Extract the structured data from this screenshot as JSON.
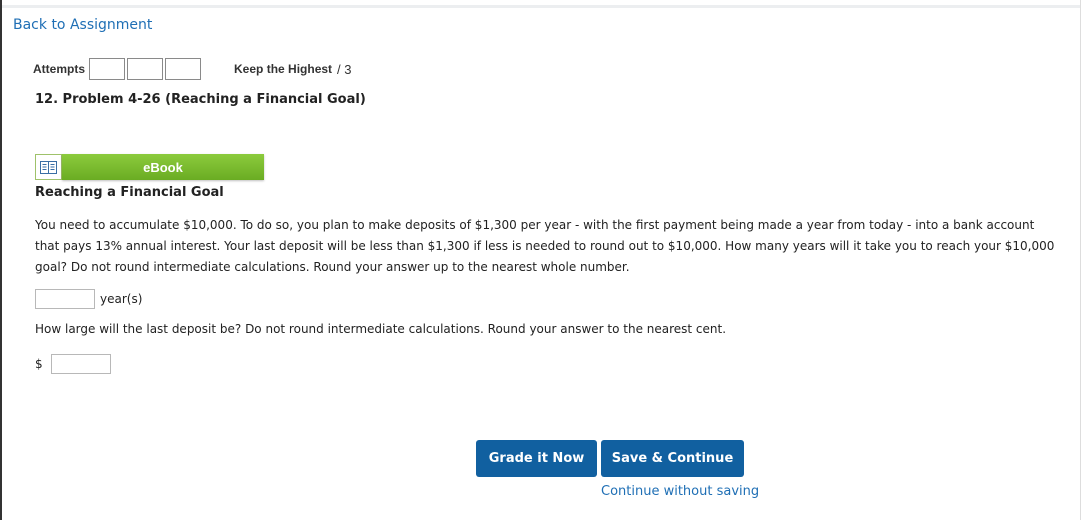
{
  "nav": {
    "back_label": "Back to Assignment"
  },
  "attempts": {
    "label": "Attempts",
    "boxes": 3,
    "keep_label": "Keep the Highest",
    "score_text": "/ 3"
  },
  "problem": {
    "title": "12.  Problem 4-26 (Reaching a Financial Goal)"
  },
  "ebook": {
    "label": "eBook",
    "icon": "book-icon",
    "color": "#7cbd2e"
  },
  "content": {
    "section_title": "Reaching a Financial Goal",
    "paragraph": "You need to accumulate $10,000. To do so, you plan to make deposits of $1,300 per year - with the first payment being made a year from today - into a bank account that pays 13% annual interest. Your last deposit will be less than $1,300 if less is needed to round out to $10,000. How many years will it take you to reach your $10,000 goal? Do not round intermediate calculations. Round your answer up to the nearest whole number.",
    "answer1": {
      "value": "",
      "placeholder": "",
      "unit": "year(s)"
    },
    "question2": "How large will the last deposit be? Do not round intermediate calculations. Round your answer to the nearest cent.",
    "answer2": {
      "currency": "$",
      "value": "",
      "placeholder": ""
    }
  },
  "actions": {
    "grade_label": "Grade it Now",
    "save_label": "Save & Continue",
    "continue_label": "Continue without saving",
    "button_color": "#1160a0",
    "link_color": "#1f6fb5"
  }
}
